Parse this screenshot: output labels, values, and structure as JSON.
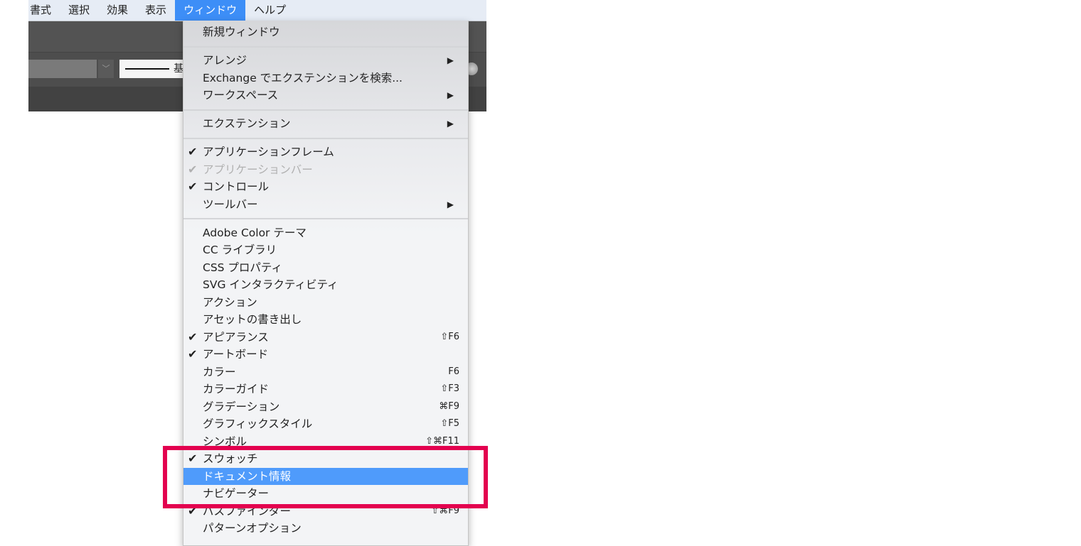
{
  "menubar": [
    "書式",
    "選択",
    "効果",
    "表示",
    "ウィンドウ",
    "ヘルプ"
  ],
  "active_menu": "ウィンドウ",
  "control": {
    "stroke_label": "基"
  },
  "highlight_color": "#e3004f",
  "menu": [
    {
      "label": "新規ウィンドウ"
    },
    {
      "sep": true
    },
    {
      "label": "アレンジ",
      "submenu": true
    },
    {
      "label": "Exchange でエクステンションを検索..."
    },
    {
      "label": "ワークスペース",
      "submenu": true
    },
    {
      "sep": true
    },
    {
      "label": "エクステンション",
      "submenu": true
    },
    {
      "sep": true
    },
    {
      "label": "アプリケーションフレーム",
      "checked": true
    },
    {
      "label": "アプリケーションバー",
      "checked": true,
      "disabled": true
    },
    {
      "label": "コントロール",
      "checked": true
    },
    {
      "label": "ツールバー",
      "submenu": true
    },
    {
      "sep": true
    },
    {
      "label": "Adobe Color テーマ"
    },
    {
      "label": "CC ライブラリ"
    },
    {
      "label": "CSS プロパティ"
    },
    {
      "label": "SVG インタラクティビティ"
    },
    {
      "label": "アクション"
    },
    {
      "label": "アセットの書き出し"
    },
    {
      "label": "アピアランス",
      "checked": true,
      "shortcut": "⇧F6"
    },
    {
      "label": "アートボード",
      "checked": true
    },
    {
      "label": "カラー",
      "shortcut": "F6"
    },
    {
      "label": "カラーガイド",
      "shortcut": "⇧F3"
    },
    {
      "label": "グラデーション",
      "shortcut": "⌘F9"
    },
    {
      "label": "グラフィックスタイル",
      "shortcut": "⇧F5"
    },
    {
      "label": "シンボル",
      "shortcut": "⇧⌘F11"
    },
    {
      "label": "スウォッチ",
      "checked": true
    },
    {
      "label": "ドキュメント情報",
      "highlighted": true
    },
    {
      "label": "ナビゲーター"
    },
    {
      "label": "パスファインダー",
      "checked": true,
      "shortcut": "⇧⌘F9"
    },
    {
      "label": "パターンオプション"
    }
  ]
}
